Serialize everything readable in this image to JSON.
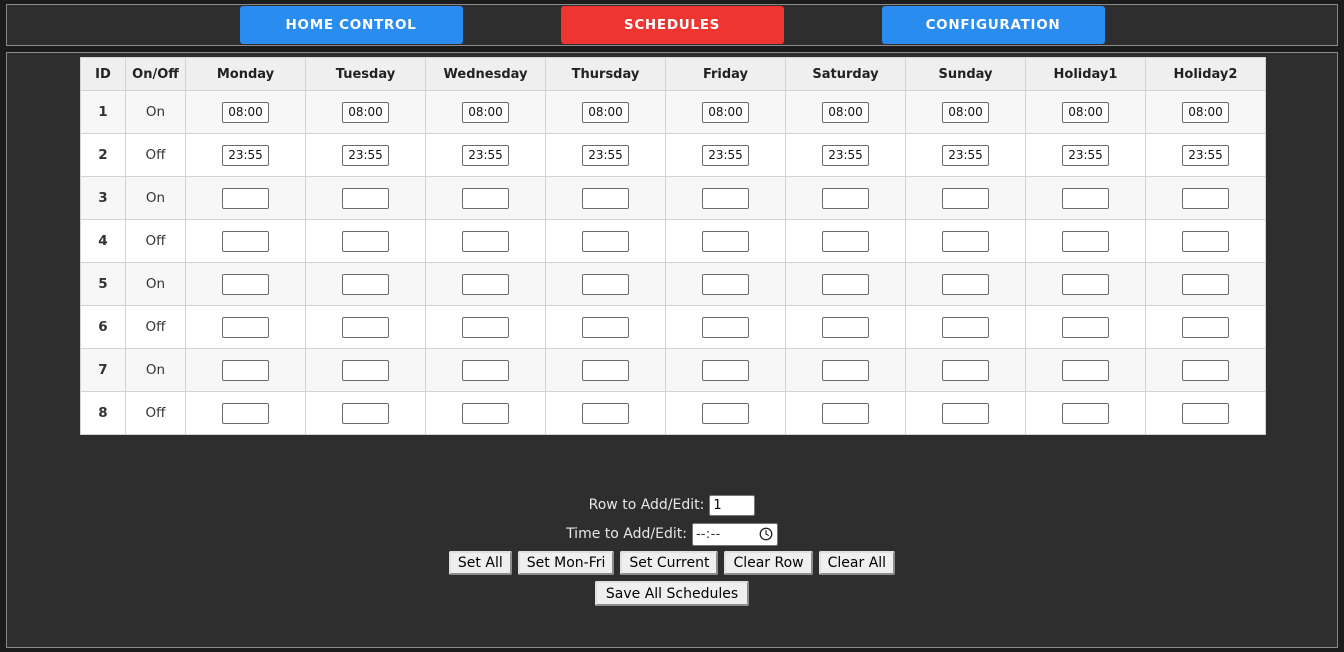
{
  "tabs": [
    {
      "label": "HOME CONTROL",
      "color": "#2b8cf0",
      "active": false,
      "name": "tab-home-control"
    },
    {
      "label": "SCHEDULES",
      "color": "#ee3532",
      "active": true,
      "name": "tab-schedules"
    },
    {
      "label": "CONFIGURATION",
      "color": "#2b8cf0",
      "active": false,
      "name": "tab-configuration"
    }
  ],
  "table": {
    "headers": [
      "ID",
      "On/Off",
      "Monday",
      "Tuesday",
      "Wednesday",
      "Thursday",
      "Friday",
      "Saturday",
      "Sunday",
      "Holiday1",
      "Holiday2"
    ],
    "rows": [
      {
        "id": "1",
        "state": "On",
        "times": [
          "08:00",
          "08:00",
          "08:00",
          "08:00",
          "08:00",
          "08:00",
          "08:00",
          "08:00",
          "08:00"
        ]
      },
      {
        "id": "2",
        "state": "Off",
        "times": [
          "23:55",
          "23:55",
          "23:55",
          "23:55",
          "23:55",
          "23:55",
          "23:55",
          "23:55",
          "23:55"
        ]
      },
      {
        "id": "3",
        "state": "On",
        "times": [
          "",
          "",
          "",
          "",
          "",
          "",
          "",
          "",
          ""
        ]
      },
      {
        "id": "4",
        "state": "Off",
        "times": [
          "",
          "",
          "",
          "",
          "",
          "",
          "",
          "",
          ""
        ]
      },
      {
        "id": "5",
        "state": "On",
        "times": [
          "",
          "",
          "",
          "",
          "",
          "",
          "",
          "",
          ""
        ]
      },
      {
        "id": "6",
        "state": "Off",
        "times": [
          "",
          "",
          "",
          "",
          "",
          "",
          "",
          "",
          ""
        ]
      },
      {
        "id": "7",
        "state": "On",
        "times": [
          "",
          "",
          "",
          "",
          "",
          "",
          "",
          "",
          ""
        ]
      },
      {
        "id": "8",
        "state": "Off",
        "times": [
          "",
          "",
          "",
          "",
          "",
          "",
          "",
          "",
          ""
        ]
      }
    ]
  },
  "controls": {
    "row_label": "Row to Add/Edit:",
    "row_value": "1",
    "time_label": "Time to Add/Edit:",
    "time_value": "--:--",
    "time_icon": "clock-icon",
    "buttons": [
      {
        "label": "Set All",
        "name": "set-all-button"
      },
      {
        "label": "Set Mon-Fri",
        "name": "set-mon-fri-button"
      },
      {
        "label": "Set Current",
        "name": "set-current-button"
      },
      {
        "label": "Clear Row",
        "name": "clear-row-button"
      },
      {
        "label": "Clear All",
        "name": "clear-all-button"
      }
    ],
    "save_label": "Save All Schedules"
  },
  "theme": {
    "page_bg": "#1c1c1c",
    "panel_bg": "#2e2e2e",
    "panel_border": "#8a8a8a",
    "accent_blue": "#2b8cf0",
    "accent_red": "#ee3532",
    "row_odd": "#f7f7f7",
    "row_even": "#ffffff",
    "header_bg": "#efefef"
  }
}
